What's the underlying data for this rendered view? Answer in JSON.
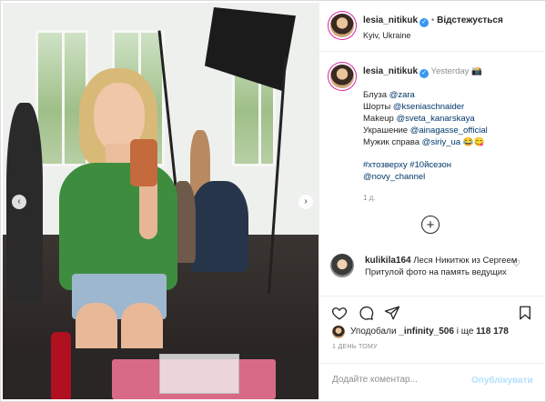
{
  "header": {
    "username": "lesia_nitikuk",
    "verified_icon": "verified-badge-icon",
    "separator": "•",
    "follow_label": "Відстежується",
    "location": "Kyiv, Ukraine"
  },
  "caption": {
    "username": "lesia_nitikuk",
    "time": "Yesterday",
    "lines": [
      {
        "text": "Блуза ",
        "mention": "@zara"
      },
      {
        "text": "Шорты ",
        "mention": "@kseniaschnaider"
      },
      {
        "text": "Makeup ",
        "mention": "@sveta_kanarskaya"
      },
      {
        "text": "Украшение ",
        "mention": "@ainagasse_official"
      },
      {
        "text": "Мужик справа ",
        "mention": "@siriy_ua",
        "emoji": "😂😋"
      }
    ],
    "hashtags": "#хтозверху #10йсезон",
    "hashtag_mention": "@novy_channel",
    "age": "1 д."
  },
  "comment": {
    "username": "kulikila164",
    "text": "Леся Никитюк из Сергеем Притулой фото на память ведущих"
  },
  "likes": {
    "prefix": "Уподобали",
    "user": "_infinity_506",
    "middle": "і ще",
    "count": "118 178"
  },
  "timestamp": "1 ДЕНЬ ТОМУ",
  "add_comment": {
    "placeholder": "Додайте коментар...",
    "post_label": "Опублікувати"
  },
  "colors": {
    "link": "#00376b",
    "verified": "#3897f0",
    "post_disabled": "#b2dffc"
  }
}
